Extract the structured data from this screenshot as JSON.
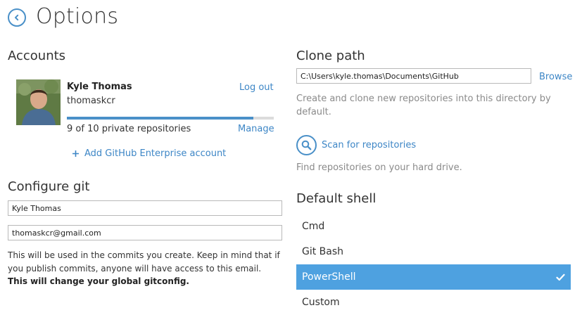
{
  "header": {
    "title": "Options"
  },
  "accounts": {
    "title": "Accounts",
    "user_name": "Kyle Thomas",
    "login": "thomaskcr",
    "logout_label": "Log out",
    "quota_text": "9 of 10 private repositories",
    "quota_fraction": 0.9,
    "manage_label": "Manage",
    "add_enterprise_label": "Add GitHub Enterprise account"
  },
  "git": {
    "title": "Configure git",
    "name_value": "Kyle Thomas",
    "email_value": "thomaskcr@gmail.com",
    "help_text": "This will be used in the commits you create. Keep in mind that if you publish commits, anyone will have access to this email.",
    "help_bold": "This will change your global gitconfig."
  },
  "clone": {
    "title": "Clone path",
    "path_value": "C:\\Users\\kyle.thomas\\Documents\\GitHub",
    "browse_label": "Browse",
    "description": "Create and clone new repositories into this directory by default.",
    "scan_label": "Scan for repositories",
    "scan_description": "Find repositories on your hard drive."
  },
  "shell": {
    "title": "Default shell",
    "options": [
      "Cmd",
      "Git Bash",
      "PowerShell",
      "Custom"
    ],
    "selected": "PowerShell"
  },
  "colors": {
    "accent": "#4a90c8",
    "selected_row": "#4ea1e0",
    "link": "#3d86c6"
  }
}
